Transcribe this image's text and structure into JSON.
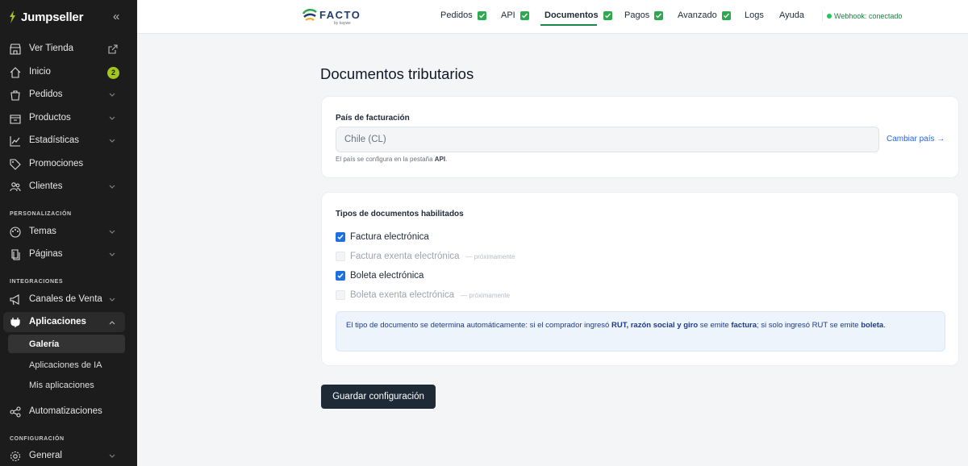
{
  "sidebar": {
    "brand": "Jumpseller",
    "collapse_icon": "double-chevron-left-icon",
    "items": [
      {
        "label": "Ver Tienda"
      },
      {
        "label": "Inicio",
        "badge": "2"
      },
      {
        "label": "Pedidos"
      },
      {
        "label": "Productos"
      },
      {
        "label": "Estadísticas"
      },
      {
        "label": "Promociones"
      },
      {
        "label": "Clientes"
      }
    ],
    "section_personalizacion": "PERSONALIZACIÓN",
    "items_personalizacion": [
      {
        "label": "Temas"
      },
      {
        "label": "Páginas"
      }
    ],
    "section_integraciones": "INTEGRACIONES",
    "items_integraciones": [
      {
        "label": "Canales de Venta"
      },
      {
        "label": "Aplicaciones"
      }
    ],
    "apps_sub": [
      {
        "label": "Galería"
      },
      {
        "label": "Aplicaciones de IA"
      },
      {
        "label": "Mis aplicaciones"
      }
    ],
    "automation": "Automatizaciones",
    "section_configuracion": "CONFIGURACIÓN",
    "items_configuracion": [
      {
        "label": "General"
      }
    ]
  },
  "topbar": {
    "logo": "FACTO",
    "logo_sub": "by kaywe",
    "tabs": [
      {
        "label": "Pedidos",
        "checked": true
      },
      {
        "label": "API",
        "checked": true
      },
      {
        "label": "Documentos",
        "checked": true,
        "active": true
      },
      {
        "label": "Pagos",
        "checked": true
      },
      {
        "label": "Avanzado",
        "checked": true
      },
      {
        "label": "Logs"
      },
      {
        "label": "Ayuda"
      }
    ],
    "webhook": "Webhook: conectado"
  },
  "main": {
    "title": "Documentos tributarios",
    "billing": {
      "label": "País de facturación",
      "value": "Chile (CL)",
      "change_link": "Cambiar país →",
      "help_prefix": "El país se configura en la pestaña ",
      "help_tab": "API",
      "help_suffix": "."
    },
    "types": {
      "title": "Tipos de documentos habilitados",
      "items": [
        {
          "label": "Factura electrónica",
          "checked": true
        },
        {
          "label": "Factura exenta electrónica",
          "checked": false,
          "note": "— próximamente"
        },
        {
          "label": "Boleta electrónica",
          "checked": true
        },
        {
          "label": "Boleta exenta electrónica",
          "checked": false,
          "note": "— próximamente"
        }
      ],
      "info": {
        "p1": "El tipo de documento se determina automáticamente: si el comprador ingresó ",
        "b1": "RUT, razón social y giro",
        "p2": " se emite ",
        "b2": "factura",
        "p3": "; si solo ingresó RUT se emite ",
        "b3": "boleta",
        "p4": "."
      }
    },
    "save_button": "Guardar configuración"
  },
  "colors": {
    "sidebar_bg": "#1c1c1c",
    "accent_green": "#2ea84f",
    "checkbox_blue": "#1e6fe0",
    "button_dark": "#1f2a37"
  }
}
